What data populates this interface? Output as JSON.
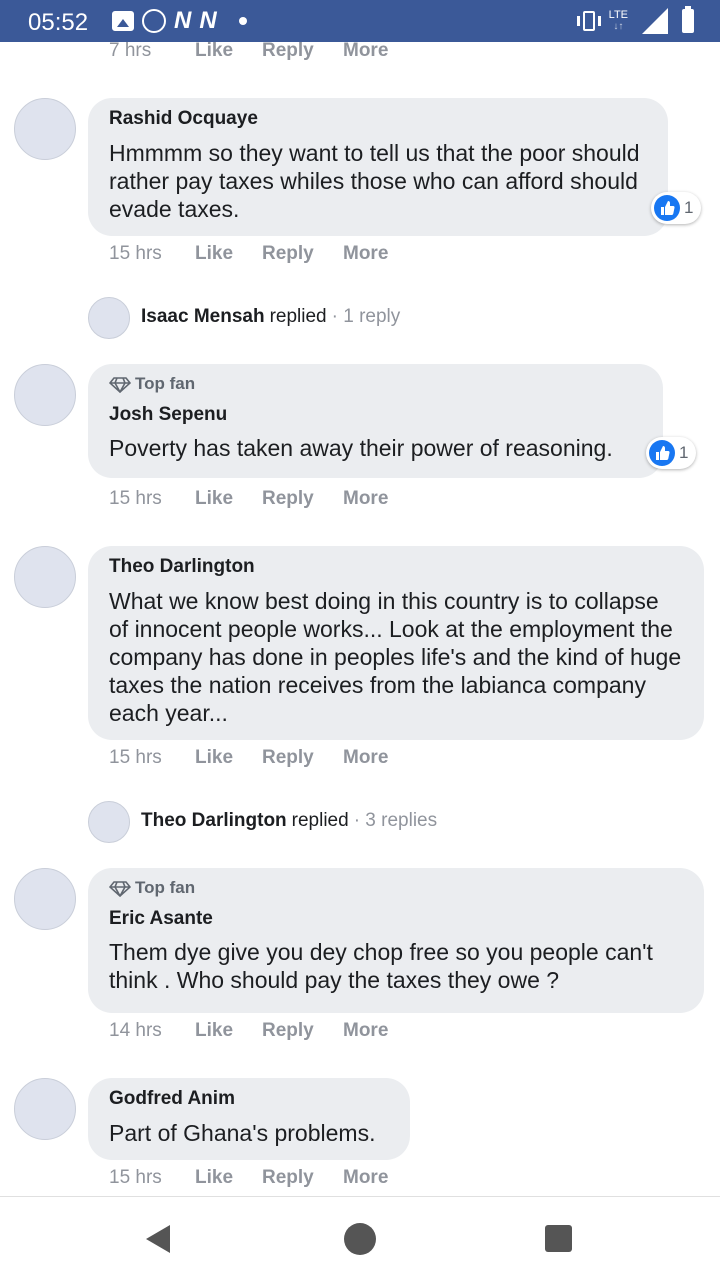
{
  "status_bar": {
    "time": "05:52",
    "notification_icons": [
      "image-icon",
      "whatsapp-icon",
      "n-icon",
      "n-icon",
      "dot-icon"
    ],
    "n_glyph": "N",
    "network": "LTE",
    "network_arrows": "↓↑",
    "right_icons": [
      "vibrate-icon",
      "lte-icon",
      "signal-icon",
      "battery-icon"
    ]
  },
  "meta_labels": {
    "like": "Like",
    "reply": "Reply",
    "more": "More"
  },
  "top_partial": {
    "time": "7 hrs"
  },
  "comments": [
    {
      "name": "Rashid Ocquaye",
      "text": "Hmmmm so they want to tell us that the poor should rather pay taxes whiles those who can afford should evade taxes.",
      "time": "15 hrs",
      "reactions": "1",
      "reaction_icon": "like-icon"
    },
    {
      "badge": "Top fan",
      "name": "Josh Sepenu",
      "text": "Poverty has taken away their power of reasoning.",
      "time": "15 hrs",
      "reactions": "1",
      "reaction_icon": "like-icon"
    },
    {
      "name": "Theo Darlington",
      "text": "What we know best doing in this country is to collapse of innocent people works... Look at the employment the company has done in peoples life's and the kind of huge taxes the nation receives from the labianca company each year...",
      "time": "15 hrs"
    },
    {
      "badge": "Top fan",
      "name": "Eric Asante",
      "text": "Them dye give you dey chop free so you people can't think . Who should pay the taxes they owe ?",
      "time": "14 hrs"
    },
    {
      "name": "Godfred Anim",
      "text": "Part of Ghana's problems.",
      "time": "15 hrs"
    }
  ],
  "reply_threads": [
    {
      "name": "Isaac Mensah",
      "label": "replied",
      "count": "· 1 reply"
    },
    {
      "name": "Theo Darlington",
      "label": "replied",
      "count": "· 3 replies"
    }
  ],
  "nav_bar": {
    "icons": [
      "back-icon",
      "home-icon",
      "recent-apps-icon"
    ]
  },
  "colors": {
    "status_bar": "#3b5998",
    "bubble": "#ebedf0",
    "like_blue": "#1877f2",
    "meta_gray": "#90949c"
  }
}
